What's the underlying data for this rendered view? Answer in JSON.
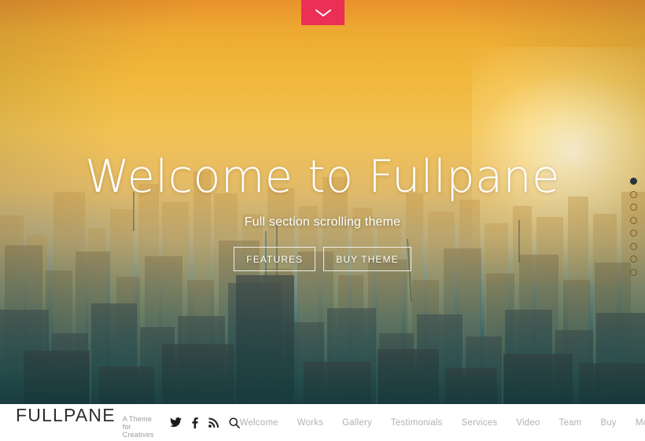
{
  "top_tab": {
    "icon": "chevron-down-icon",
    "color": "#ec2f55",
    "label": ""
  },
  "hero": {
    "title": "Welcome to Fullpane",
    "subtitle": "Full section scrolling theme",
    "buttons": [
      {
        "label": "FEATURES"
      },
      {
        "label": "BUY THEME"
      }
    ],
    "background_description": "Hazy sunrise city skyline, orange to teal gradient"
  },
  "dot_nav": {
    "count": 8,
    "active_index": 0,
    "active_color": "#26343a",
    "inactive_border_color": "#6e4619"
  },
  "footer_bar": {
    "brand": "FULLPANE",
    "tagline": "A Theme for Creatives",
    "social": [
      {
        "name": "twitter-icon"
      },
      {
        "name": "facebook-icon"
      },
      {
        "name": "rss-icon"
      },
      {
        "name": "search-icon"
      }
    ],
    "nav": [
      {
        "label": "Welcome",
        "caret": false
      },
      {
        "label": "Works",
        "caret": false
      },
      {
        "label": "Gallery",
        "caret": false
      },
      {
        "label": "Testimonials",
        "caret": false
      },
      {
        "label": "Services",
        "caret": false
      },
      {
        "label": "Video",
        "caret": false
      },
      {
        "label": "Team",
        "caret": false
      },
      {
        "label": "Buy",
        "caret": false
      },
      {
        "label": "More",
        "caret": true
      }
    ],
    "background": "#ffffff",
    "nav_color": "#b2b2b2"
  }
}
